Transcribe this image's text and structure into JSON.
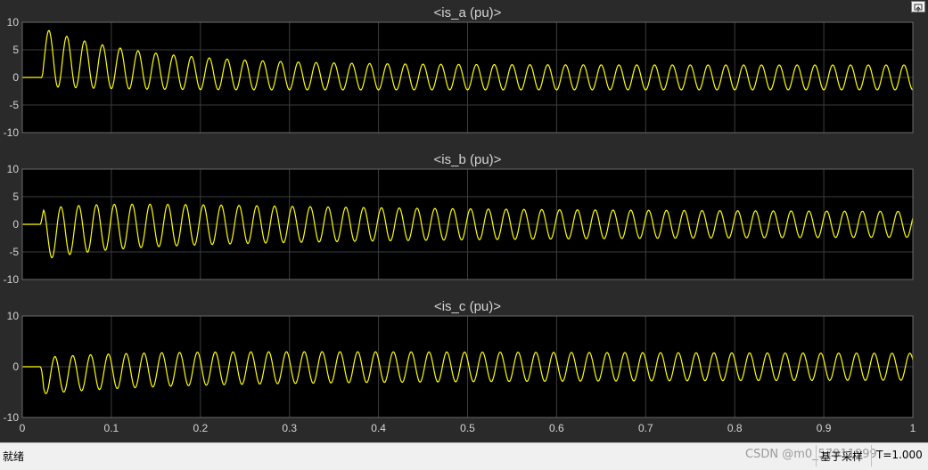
{
  "window": {
    "restore_icon": "undock-icon"
  },
  "status_bar": {
    "left_text": "就绪",
    "watermark": "CSDN @m0_57911999",
    "sample_mode": "基于采样",
    "time": "T=1.000"
  },
  "colors": {
    "background": "#2a2a2a",
    "plot_bg": "#000000",
    "trace": "#ffff00",
    "grid": "#3c3c3c",
    "text": "#d4d4d4"
  },
  "chart_data": [
    {
      "type": "line",
      "title": "<is_a (pu)>",
      "x_ticks": [
        "0",
        "0.1",
        "0.2",
        "0.3",
        "0.4",
        "0.5",
        "0.6",
        "0.7",
        "0.8",
        "0.9",
        "1"
      ],
      "y_ticks": [
        "10",
        "5",
        "0",
        "-5",
        "-10"
      ],
      "xlim": [
        0,
        1
      ],
      "ylim": [
        -10,
        10
      ],
      "grid": true,
      "series": [
        {
          "frequency_hz": 50,
          "start_time": 0.02,
          "initial_offset": 3.7,
          "offset_time_constant": 0.11,
          "initial_amplitude": 5.3,
          "final_amplitude": 2.25,
          "amplitude_time_constant": 0.12,
          "phase_deg": -90,
          "x": [
            0,
            0.02,
            0.03,
            0.05,
            0.1,
            0.2,
            0.3,
            0.5,
            0.7,
            1.0
          ],
          "y_peak": [
            0,
            0,
            9,
            8,
            6.8,
            4.8,
            3.9,
            3.0,
            2.6,
            2.3
          ],
          "y_trough": [
            0,
            0,
            -0.5,
            -0.8,
            -1.5,
            -2.7,
            -2.9,
            -2.6,
            -2.5,
            -2.2
          ]
        }
      ]
    },
    {
      "type": "line",
      "title": "<is_b (pu)>",
      "x_ticks": [
        "0",
        "0.1",
        "0.2",
        "0.3",
        "0.4",
        "0.5",
        "0.6",
        "0.7",
        "0.8",
        "0.9",
        "1"
      ],
      "y_ticks": [
        "10",
        "5",
        "0",
        "-5",
        "-10"
      ],
      "xlim": [
        0,
        1
      ],
      "ylim": [
        -10,
        10
      ],
      "grid": true,
      "series": [
        {
          "frequency_hz": 50,
          "start_time": 0.02,
          "initial_offset": -1.9,
          "offset_time_constant": 0.06,
          "initial_amplitude": 4.6,
          "final_amplitude": 2.2,
          "amplitude_time_constant": 0.35,
          "phase_deg": 30,
          "x": [
            0,
            0.02,
            0.03,
            0.05,
            0.1,
            0.2,
            0.3,
            0.5,
            0.7,
            1.0
          ],
          "y_peak": [
            0,
            0,
            3,
            3.3,
            3.5,
            3.6,
            3.3,
            2.9,
            2.6,
            2.3
          ],
          "y_trough": [
            0,
            0,
            -6.6,
            -6,
            -5,
            -4,
            -3.6,
            -3,
            -2.6,
            -2.3
          ]
        }
      ]
    },
    {
      "type": "line",
      "title": "<is_c (pu)>",
      "x_ticks": [
        "0",
        "0.1",
        "0.2",
        "0.3",
        "0.4",
        "0.5",
        "0.6",
        "0.7",
        "0.8",
        "0.9",
        "1"
      ],
      "y_ticks": [
        "10",
        "0",
        "-10"
      ],
      "xlim": [
        0,
        1
      ],
      "ylim": [
        -10,
        10
      ],
      "grid": true,
      "series": [
        {
          "frequency_hz": 50,
          "start_time": 0.02,
          "initial_offset": -1.8,
          "offset_time_constant": 0.12,
          "initial_amplitude": 3.6,
          "final_amplitude": 2.5,
          "amplitude_time_constant": 0.5,
          "phase_deg": 150,
          "x": [
            0,
            0.02,
            0.03,
            0.05,
            0.1,
            0.2,
            0.3,
            0.5,
            0.7,
            1.0
          ],
          "y_peak": [
            0,
            0,
            2.2,
            2.5,
            2.9,
            3.3,
            3.2,
            3.0,
            2.8,
            2.4
          ],
          "y_trough": [
            0,
            0,
            -7.2,
            -6.4,
            -4.6,
            -3.6,
            -3.3,
            -3.0,
            -2.8,
            -2.4
          ]
        }
      ]
    }
  ]
}
